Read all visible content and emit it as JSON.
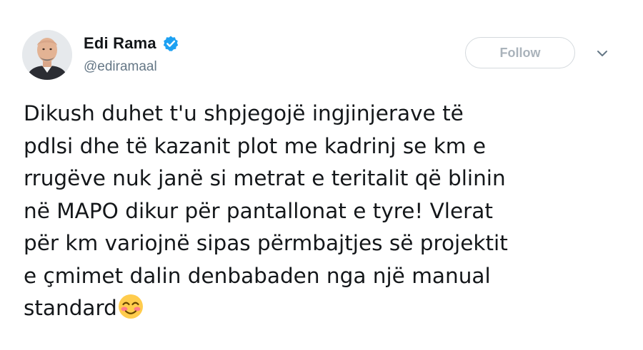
{
  "user": {
    "display_name": "Edi Rama",
    "handle": "@ediramaal",
    "verified": true,
    "avatar_icon": "profile-photo"
  },
  "actions": {
    "follow_label": "Follow",
    "more_icon": "chevron-down-icon"
  },
  "tweet": {
    "lines": [
      "Dikush duhet t'u shpjegojë ingjinjerave të",
      "pdlsi dhe të kazanit plot me kadrinj se km e",
      "rrugëve nuk janë si metrat e teritalit që blinin",
      "në MAPO dikur për pantallonat e tyre! Vlerat",
      "për km variojnë sipas përmbajtjes së projektit",
      "e çmimet dalin denbabaden nga një manual",
      "standard"
    ],
    "emoji": "smiling-face-with-smiling-eyes"
  },
  "colors": {
    "text": "#14171a",
    "secondary": "#657786",
    "verified_blue": "#1da1f2",
    "follow_border": "#d4d9dd",
    "follow_text": "#aab3bb"
  }
}
